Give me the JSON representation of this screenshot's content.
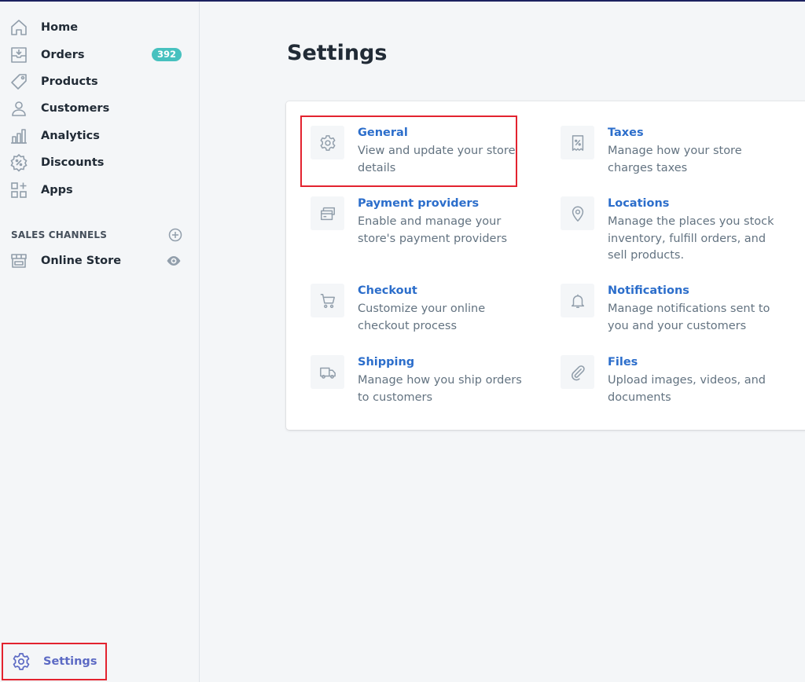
{
  "nav": {
    "home": "Home",
    "orders": "Orders",
    "orders_badge": "392",
    "products": "Products",
    "customers": "Customers",
    "analytics": "Analytics",
    "discounts": "Discounts",
    "apps": "Apps"
  },
  "sales_channels": {
    "title": "SALES CHANNELS",
    "online_store": "Online Store"
  },
  "settings_label": "Settings",
  "page": {
    "title": "Settings"
  },
  "settings_items": {
    "general": {
      "title": "General",
      "desc": "View and update your store details"
    },
    "taxes": {
      "title": "Taxes",
      "desc": "Manage how your store charges taxes"
    },
    "payments": {
      "title": "Payment providers",
      "desc": "Enable and manage your store's payment providers"
    },
    "locations": {
      "title": "Locations",
      "desc": "Manage the places you stock inventory, fulfill orders, and sell products."
    },
    "checkout": {
      "title": "Checkout",
      "desc": "Customize your online checkout process"
    },
    "notifications": {
      "title": "Notifications",
      "desc": "Manage notifications sent to you and your customers"
    },
    "shipping": {
      "title": "Shipping",
      "desc": "Manage how you ship orders to customers"
    },
    "files": {
      "title": "Files",
      "desc": "Upload images, videos, and documents"
    }
  },
  "colors": {
    "accent": "#5c6ac4",
    "link": "#2c6ecb",
    "badge": "#47c1bf",
    "highlight": "#e3232f"
  },
  "icons": {
    "nav": [
      "home-icon",
      "orders-icon",
      "products-icon",
      "customers-icon",
      "analytics-icon",
      "discounts-icon",
      "apps-icon"
    ],
    "channels": [
      "add-channel-icon",
      "online-store-icon",
      "eye-icon"
    ],
    "settings": [
      "gear-icon",
      "receipt-icon",
      "credit-card-icon",
      "location-pin-icon",
      "cart-icon",
      "bell-icon",
      "truck-icon",
      "paperclip-icon"
    ]
  }
}
